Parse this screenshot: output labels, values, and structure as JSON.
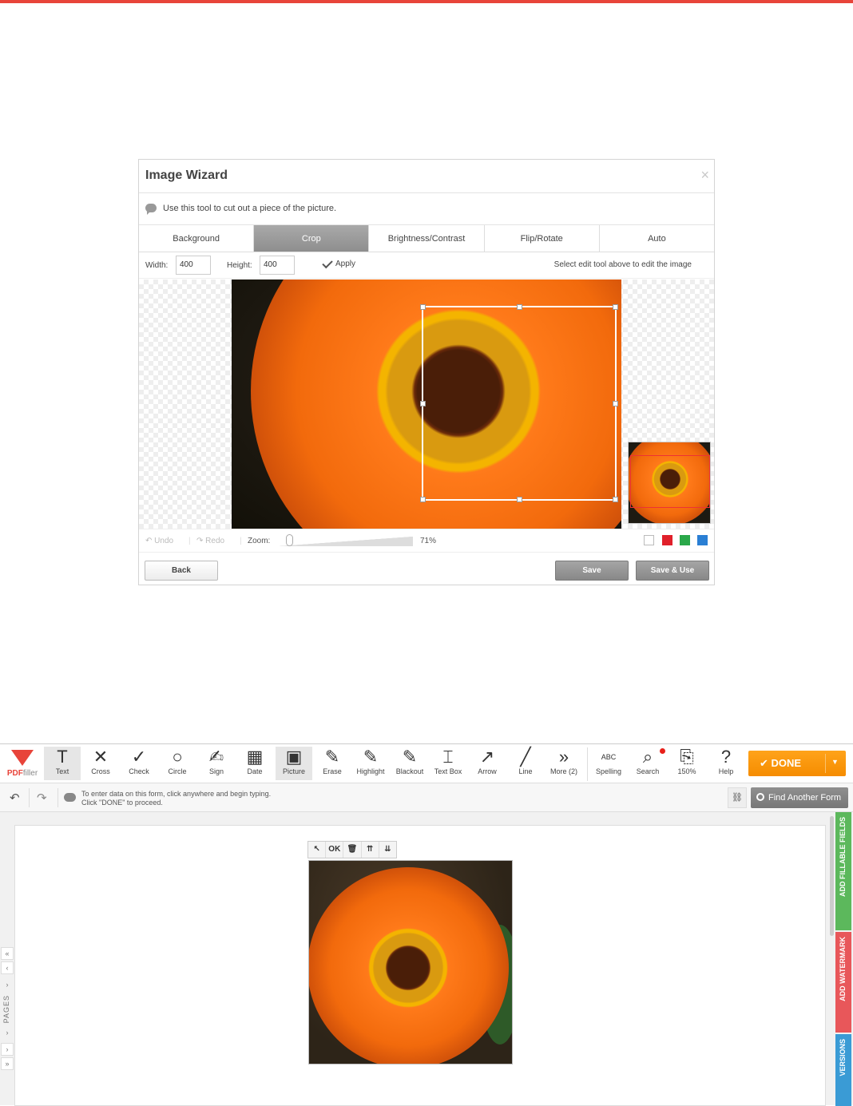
{
  "wizard": {
    "title": "Image Wizard",
    "close": "×",
    "hint": "Use this tool to cut out a piece of the picture.",
    "tabs": [
      "Background",
      "Crop",
      "Brightness/Contrast",
      "Flip/Rotate",
      "Auto"
    ],
    "active_tab": "Crop",
    "width_label": "Width:",
    "width_value": "400",
    "height_label": "Height:",
    "height_value": "400",
    "apply_label": "Apply",
    "right_hint": "Select edit tool above to edit the image",
    "undo_label": "Undo",
    "redo_label": "Redo",
    "zoom_label": "Zoom:",
    "zoom_value": "71%",
    "swatch_colors": [
      "#ffffff",
      "#e0202a",
      "#2aa84a",
      "#2a7fd4"
    ],
    "back_label": "Back",
    "save_label": "Save",
    "save_use_label": "Save & Use"
  },
  "editor": {
    "brand": {
      "name1": "PDF",
      "name2": "filler"
    },
    "tools": [
      {
        "label": "Text",
        "icon": "T"
      },
      {
        "label": "Cross",
        "icon": "✕"
      },
      {
        "label": "Check",
        "icon": "✓"
      },
      {
        "label": "Circle",
        "icon": "○"
      },
      {
        "label": "Sign",
        "icon": "✍"
      },
      {
        "label": "Date",
        "icon": "▦"
      },
      {
        "label": "Picture",
        "icon": "▣"
      },
      {
        "label": "Erase",
        "icon": "✎"
      },
      {
        "label": "Highlight",
        "icon": "✎"
      },
      {
        "label": "Blackout",
        "icon": "✎"
      },
      {
        "label": "Text Box",
        "icon": "⌶"
      },
      {
        "label": "Arrow",
        "icon": "↗"
      },
      {
        "label": "Line",
        "icon": "╱"
      },
      {
        "label": "More (2)",
        "icon": "»"
      }
    ],
    "tools_right": [
      {
        "label": "Spelling",
        "icon": "ABC"
      },
      {
        "label": "Search",
        "icon": "⌕"
      },
      {
        "label": "150%",
        "icon": "⎘"
      },
      {
        "label": "Help",
        "icon": "?"
      }
    ],
    "done_label": "DONE",
    "info_line1": "To enter data on this form, click anywhere and begin typing.",
    "info_line2": "Click \"DONE\" to proceed.",
    "find_label": "Find Another Form",
    "pages_label": "PAGES",
    "object_toolbar": [
      "↖",
      "OK",
      "🗑",
      "⇈",
      "⇊"
    ],
    "side_tabs": [
      {
        "label": "ADD FILLABLE FIELDS",
        "color": "#5cb85c"
      },
      {
        "label": "ADD WATERMARK",
        "color": "#e8575a"
      },
      {
        "label": "VERSIONS",
        "color": "#3a9bd5"
      }
    ],
    "active_tool": "Picture"
  }
}
